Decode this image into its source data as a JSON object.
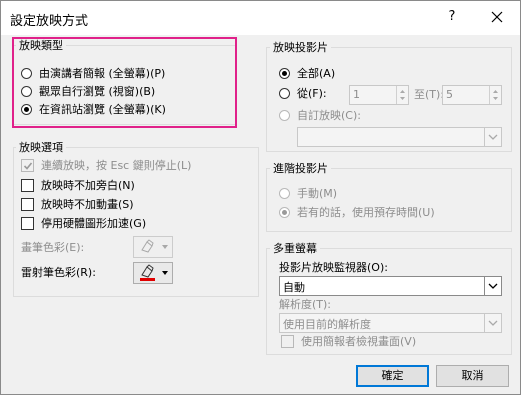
{
  "window": {
    "title": "設定放映方式",
    "help_glyph": "?"
  },
  "show_type": {
    "label": "放映類型",
    "options": [
      {
        "label": "由演講者簡報 (全螢幕)(P)",
        "selected": false
      },
      {
        "label": "觀眾自行瀏覽 (視窗)(B)",
        "selected": false
      },
      {
        "label": "在資訊站瀏覽 (全螢幕)(K)",
        "selected": true
      }
    ]
  },
  "show_options": {
    "label": "放映選項",
    "checkboxes": [
      {
        "label": "連續放映，按 Esc 鍵則停止(L)",
        "checked": true,
        "disabled": true
      },
      {
        "label": "放映時不加旁白(N)",
        "checked": false,
        "disabled": false
      },
      {
        "label": "放映時不加動畫(S)",
        "checked": false,
        "disabled": false
      },
      {
        "label": "停用硬體圖形加速(G)",
        "checked": false,
        "disabled": false
      }
    ],
    "pen_color_label": "畫筆色彩(E):",
    "laser_color_label": "雷射筆色彩(R):",
    "laser_color": "#e00000",
    "pen_icon": "pen-icon"
  },
  "show_slides": {
    "label": "放映投影片",
    "all_label": "全部(A)",
    "from_label": "從(F):",
    "from_value": "1",
    "to_label": "至(T):",
    "to_value": "5",
    "custom_label": "自訂放映(C):",
    "selected": "all"
  },
  "advance": {
    "label": "進階投影片",
    "manual_label": "手動(M)",
    "timings_label": "若有的話，使用預存時間(U)"
  },
  "multi_monitor": {
    "label": "多重螢幕",
    "monitor_label": "投影片放映監視器(O):",
    "monitor_value": "自動",
    "resolution_label": "解析度(T):",
    "resolution_value": "使用目前的解析度",
    "presenter_view_label": "使用簡報者檢視畫面(V)"
  },
  "buttons": {
    "ok": "確定",
    "cancel": "取消"
  },
  "accent": {
    "highlight": "#e0218a",
    "focus": "#0078d7"
  }
}
